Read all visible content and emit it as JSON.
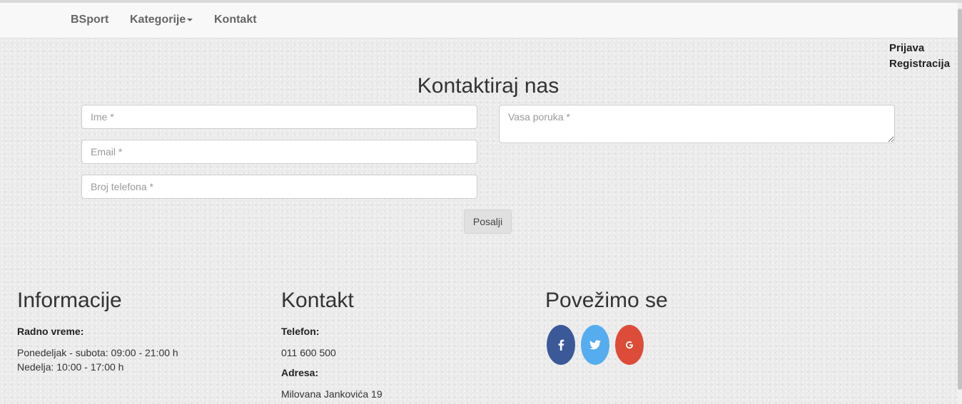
{
  "nav": {
    "brand": "BSport",
    "categories": "Kategorije",
    "contact": "Kontakt"
  },
  "auth": {
    "login": "Prijava",
    "register": "Registracija"
  },
  "form": {
    "title": "Kontaktiraj nas",
    "name_placeholder": "Ime *",
    "email_placeholder": "Email *",
    "phone_placeholder": "Broj telefona *",
    "message_placeholder": "Vasa poruka *",
    "submit_label": "Posalji"
  },
  "footer": {
    "info": {
      "title": "Informacije",
      "hours_label": "Radno vreme:",
      "hours_weekdays": "Ponedeljak - subota: 09:00 - 21:00 h",
      "hours_sunday": "Nedelja: 10:00 - 17:00 h"
    },
    "contact": {
      "title": "Kontakt",
      "phone_label": "Telefon:",
      "phone_value": "011 600 500",
      "address_label": "Adresa:",
      "address_value": "Milovana Jankovića 19"
    },
    "social": {
      "title": "Povežimo se",
      "items": [
        {
          "icon": "facebook-icon",
          "color": "#3b5998"
        },
        {
          "icon": "twitter-icon",
          "color": "#55acee"
        },
        {
          "icon": "google-icon",
          "color": "#dd4b39"
        }
      ]
    }
  }
}
